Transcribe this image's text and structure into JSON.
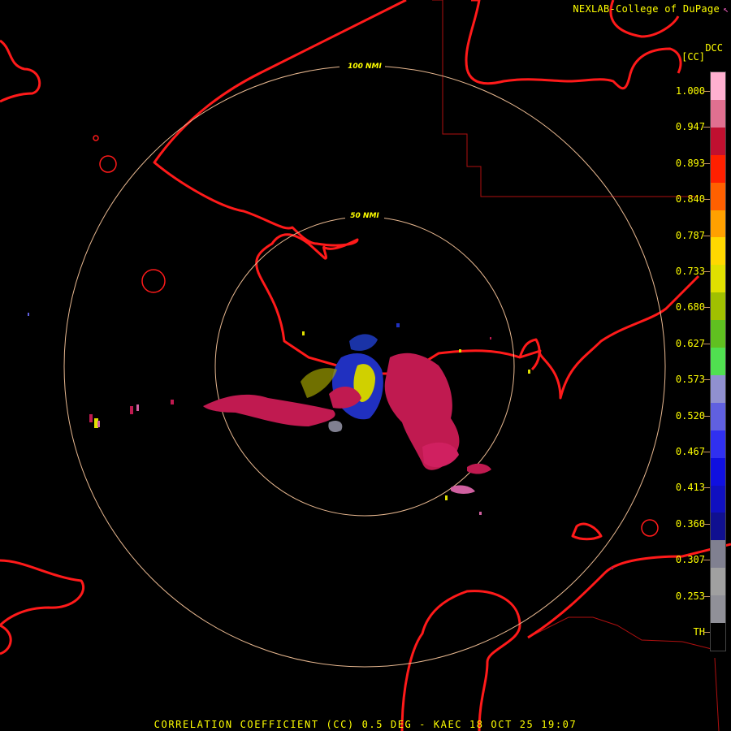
{
  "header": {
    "credit": "NEXLAB-College of DuPage",
    "credit_icon": "arrow-logo-icon",
    "product_code": "DCC",
    "product_unit": "[CC]"
  },
  "map": {
    "range_rings": [
      {
        "label": "50 NMI"
      },
      {
        "label": "100 NMI"
      }
    ],
    "colors": {
      "boundary": "#ff1a1a",
      "ring": "#e8b890",
      "county": "#b01010"
    }
  },
  "legend": {
    "ticks": [
      "1.000",
      "0.947",
      "0.893",
      "0.840",
      "0.787",
      "0.733",
      "0.680",
      "0.627",
      "0.573",
      "0.520",
      "0.467",
      "0.413",
      "0.360",
      "0.307",
      "0.253",
      "TH"
    ],
    "colors": [
      "#ffb0d0",
      "#e07090",
      "#c01030",
      "#ff2000",
      "#ff6000",
      "#ffa000",
      "#ffd800",
      "#e0e000",
      "#a0c000",
      "#60c020",
      "#50e050",
      "#9090d0",
      "#6060e0",
      "#3030f0",
      "#1010e0",
      "#1010c0",
      "#101090",
      "#808090",
      "#a0a0a0",
      "#909098",
      "#000000"
    ]
  },
  "footer": {
    "caption": "CORRELATION COEFFICIENT (CC) 0.5 DEG - KAEC 18 OCT 25 19:07"
  }
}
